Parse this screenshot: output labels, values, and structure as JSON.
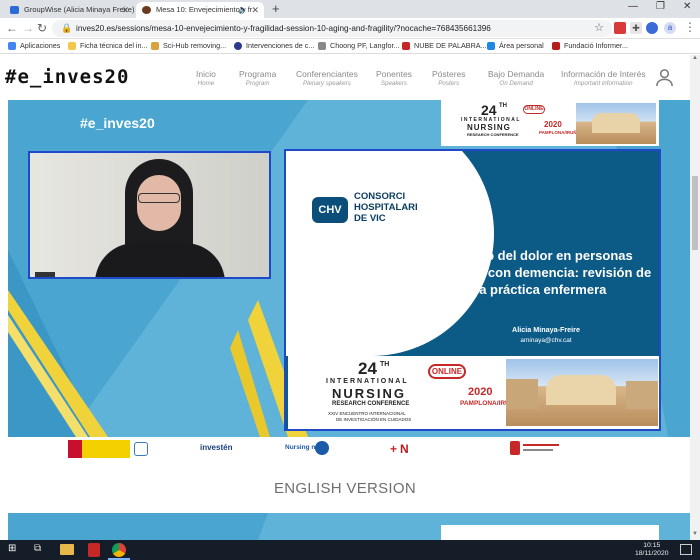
{
  "browser": {
    "tabs": [
      {
        "title": "GroupWise (Alicia Minaya Freire)",
        "active": false
      },
      {
        "title": "Mesa 10: Envejecimiento y fr",
        "active": true
      }
    ],
    "url": "inves20.es/sessions/mesa-10-envejecimiento-y-fragilidad-session-10-aging-and-fragility/?nocache=768435661396",
    "profile_initial": "a",
    "bookmarks": [
      "Aplicaciones",
      "Ficha técnica del in...",
      "Sci-Hub removing...",
      "Intervenciones de c...",
      "Choong PF, Langfor...",
      "NUBE DE PALABRA...",
      "Área personal",
      "Fundació Informer..."
    ]
  },
  "site": {
    "logo": "#e_inves20",
    "nav": [
      {
        "label": "Inicio",
        "sub": "Home"
      },
      {
        "label": "Programa",
        "sub": "Program"
      },
      {
        "label": "Conferenciantes",
        "sub": "Plenary speakers"
      },
      {
        "label": "Ponentes",
        "sub": "Speakers"
      },
      {
        "label": "Pósteres",
        "sub": "Posters"
      },
      {
        "label": "Bajo Demanda",
        "sub": "On Demand"
      },
      {
        "label": "Información de Interés",
        "sub": "Important information"
      }
    ]
  },
  "stage": {
    "hashtag": "#e_inves20",
    "banner": {
      "edition": "24",
      "edition_suffix": "TH",
      "line1": "INTERNATIONAL",
      "line2": "NURSING",
      "line3": "RESEARCH CONFERENCE",
      "line4": "XXIV ENCUENTRO INTERNACIONAL",
      "line5": "DE INVESTIGACIÓN EN CUIDADOS",
      "badge": "ONLINE",
      "year": "2020",
      "city": "PAMPLONA/IRUÑA"
    }
  },
  "slide": {
    "org_mark": "CHV",
    "org_line1": "CONSORCI",
    "org_line2": "HOSPITALARI",
    "org_line3": "DE VIC",
    "title": "Manejo del dolor en personas mayores con demencia: revisión de la práctica enfermera",
    "author": "Alicia Minaya-Freire",
    "email": "aminaya@chv.cat"
  },
  "sponsors": [
    "",
    "investén",
    "Nursing now",
    "",
    ""
  ],
  "english_version": "ENGLISH VERSION",
  "taskbar": {
    "time": "10:15",
    "date": "18/11/2020"
  },
  "colors": {
    "accent_blue": "#1f49c8",
    "stage_blue": "#5fb2d8",
    "slide_blue": "#0c5a86",
    "stripe_yellow": "#f0d33a"
  }
}
